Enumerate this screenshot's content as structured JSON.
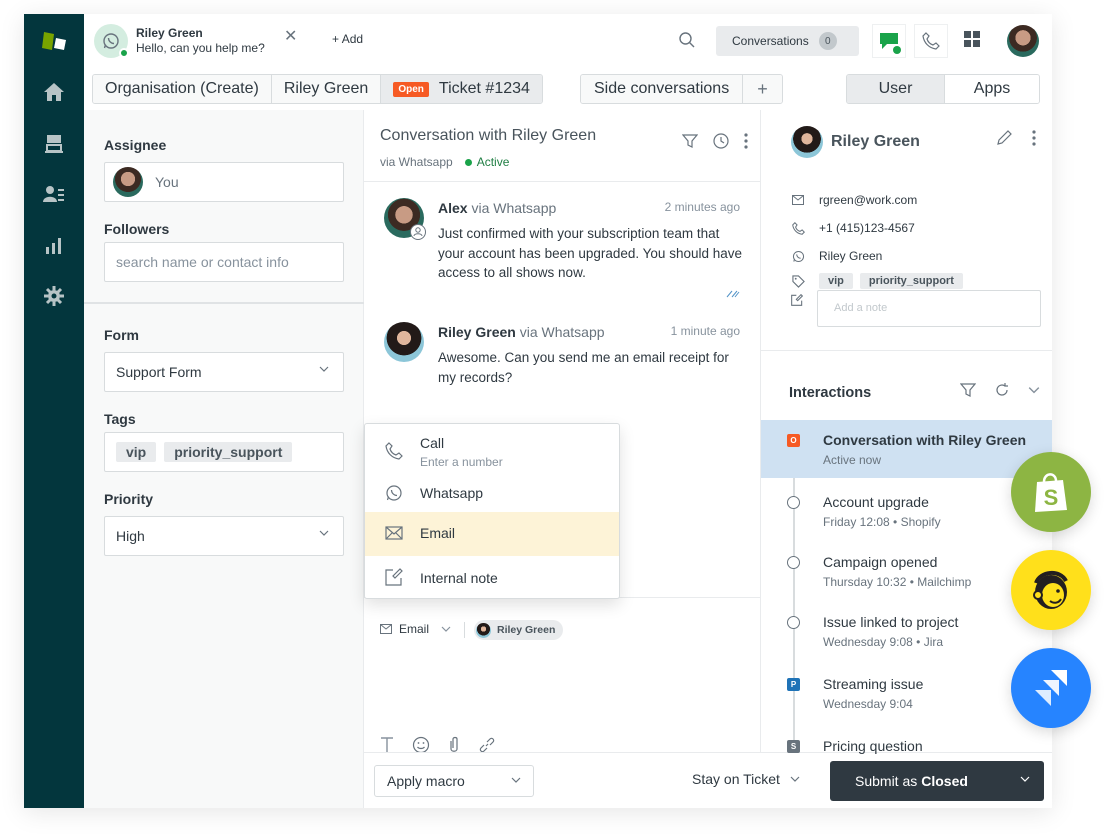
{
  "topbar": {
    "whatsapp_tab": {
      "name": "Riley Green",
      "message": "Hello, can you help me?"
    },
    "add_label": "Add",
    "conversations_label": "Conversations",
    "conversations_count": "0"
  },
  "tabs": {
    "organisation": "Organisation (Create)",
    "requester": "Riley Green",
    "ticket_status": "Open",
    "ticket": "Ticket #1234",
    "side_conversations": "Side conversations",
    "add": "+",
    "user": "User",
    "apps": "Apps"
  },
  "left_panel": {
    "assignee_label": "Assignee",
    "assignee_value": "You",
    "followers_label": "Followers",
    "followers_placeholder": "search name or contact info",
    "form_label": "Form",
    "form_value": "Support Form",
    "tags_label": "Tags",
    "tags": [
      "vip",
      "priority_support"
    ],
    "priority_label": "Priority",
    "priority_value": "High"
  },
  "conversation": {
    "title": "Conversation with Riley Green",
    "channel": "via Whatsapp",
    "status": "Active",
    "status_color": "#1aa34a",
    "messages": [
      {
        "sender": "Alex",
        "via": "via Whatsapp",
        "time": "2 minutes ago",
        "body": "Just confirmed with your subscription team that your account has been upgraded. You should have access to all shows now."
      },
      {
        "sender": "Riley Green",
        "via": "via Whatsapp",
        "time": "1 minute ago",
        "body": "Awesome. Can you send me an email receipt for my records?"
      }
    ],
    "channel_menu": [
      {
        "label": "Call",
        "sub": "Enter a number",
        "icon": "phone-icon"
      },
      {
        "label": "Whatsapp",
        "icon": "whatsapp-icon"
      },
      {
        "label": "Email",
        "icon": "mail-icon",
        "highlighted": true
      },
      {
        "label": "Internal note",
        "icon": "note-icon"
      }
    ],
    "composer": {
      "channel": "Email",
      "recipient": "Riley Green"
    }
  },
  "footer": {
    "macro": "Apply macro",
    "stay": "Stay on Ticket",
    "submit_prefix": "Submit as",
    "submit_status": "Closed"
  },
  "user_panel": {
    "name": "Riley Green",
    "email": "rgreen@work.com",
    "phone": "+1 (415)123-4567",
    "whatsapp": "Riley Green",
    "tags": [
      "vip",
      "priority_support"
    ],
    "note_placeholder": "Add a note",
    "interactions_title": "Interactions",
    "interactions": [
      {
        "title": "Conversation with Riley Green",
        "meta": "Active now",
        "marker": "square",
        "letter": "O",
        "color": "#f65a24",
        "selected": true
      },
      {
        "title": "Account upgrade",
        "meta": "Friday 12:08 • Shopify",
        "marker": "circle"
      },
      {
        "title": "Campaign opened",
        "meta": "Thursday 10:32 • Mailchimp",
        "marker": "circle"
      },
      {
        "title": "Issue linked to project",
        "meta": "Wednesday 9:08 • Jira",
        "marker": "circle"
      },
      {
        "title": "Streaming issue",
        "meta": "Wednesday 9:04",
        "marker": "square",
        "letter": "P",
        "color": "#1f73b7"
      },
      {
        "title": "Pricing question",
        "meta": "",
        "marker": "square",
        "letter": "S",
        "color": "#68737d"
      }
    ]
  },
  "integrations": [
    "Shopify",
    "Mailchimp",
    "Jira"
  ],
  "colors": {
    "nav_bg": "#03363d",
    "brand_green": "#78a300",
    "open_badge": "#f65a24",
    "submit_bg": "#2f3941",
    "selected_row": "#cfe1f2",
    "menu_highlight": "#fdf3d7"
  }
}
